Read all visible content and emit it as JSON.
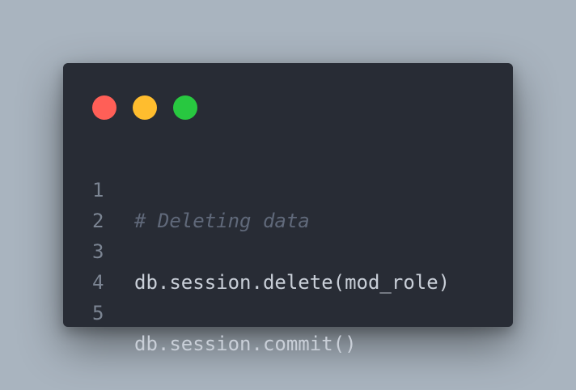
{
  "window": {
    "controls": {
      "close_color": "#ff5f57",
      "minimize_color": "#ffbd2e",
      "maximize_color": "#28c840"
    }
  },
  "code": {
    "lines": [
      {
        "number": "1",
        "text": "# Deleting data",
        "kind": "comment"
      },
      {
        "number": "2",
        "text": "",
        "kind": "blank"
      },
      {
        "number": "3",
        "text": "db.session.delete(mod_role)",
        "kind": "code"
      },
      {
        "number": "4",
        "text": "",
        "kind": "blank"
      },
      {
        "number": "5",
        "text": "db.session.commit()",
        "kind": "code"
      }
    ]
  }
}
